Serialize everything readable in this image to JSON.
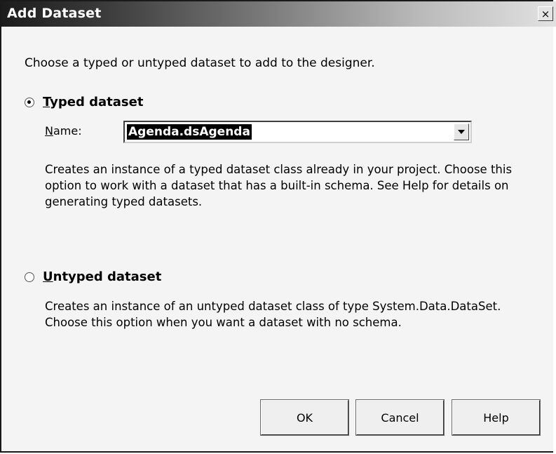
{
  "window": {
    "title": "Add Dataset",
    "close_glyph": "×"
  },
  "intro": "Choose a typed or untyped dataset to add to the designer.",
  "typed": {
    "label_first": "T",
    "label_rest": "yped dataset",
    "selected": true,
    "name_label_first": "N",
    "name_label_rest": "ame:",
    "name_value": "Agenda.dsAgenda",
    "description_lines": [
      "Creates an instance of a typed dataset class already in your project. Choose this",
      "option to work with a dataset that has a built-in schema. See Help for details on",
      "generating typed datasets."
    ]
  },
  "untyped": {
    "label_first": "U",
    "label_rest": "ntyped dataset",
    "selected": false,
    "description_lines": [
      "Creates an instance of an untyped dataset class of type System.Data.DataSet.",
      "Choose this option when you want a dataset with no schema."
    ]
  },
  "buttons": {
    "ok": "OK",
    "cancel": "Cancel",
    "help": "Help"
  },
  "icons": {
    "close": "close-icon",
    "dropdown": "chevron-down-icon",
    "radio": "radio-dot-icon"
  }
}
